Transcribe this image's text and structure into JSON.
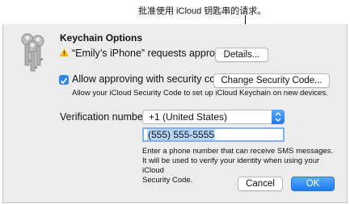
{
  "callout": {
    "text": "批准使用 iCloud 钥匙串的请求。"
  },
  "dialog": {
    "title": "Keychain Options",
    "request_text": "“Emily’s iPhone” requests approval",
    "details_button": "Details...",
    "allow_checkbox_label": "Allow approving with security code",
    "allow_checked": true,
    "change_code_button": "Change Security Code...",
    "allow_note": "Allow your iCloud Security Code to set up iCloud Keychain on new devices.",
    "verification_label": "Verification number:",
    "country_selected": "+1 (United States)",
    "phone_value": "(555) 555-5555",
    "phone_note_line1": "Enter a phone number that can receive SMS messages.",
    "phone_note_line2": "It will be used to verify your identity when using your iCloud",
    "phone_note_line3": "Security Code.",
    "cancel_button": "Cancel",
    "ok_button": "OK"
  },
  "colors": {
    "accent": "#1b7bf3",
    "warning": "#f5b800",
    "sheet_bg": "#ececec"
  }
}
